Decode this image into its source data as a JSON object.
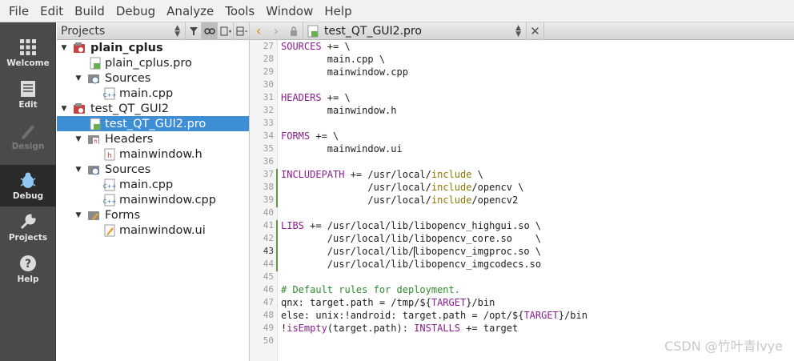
{
  "menu": [
    "File",
    "Edit",
    "Build",
    "Debug",
    "Analyze",
    "Tools",
    "Window",
    "Help"
  ],
  "modes": [
    {
      "label": "Welcome",
      "icon": "grid-icon",
      "state": "normal"
    },
    {
      "label": "Edit",
      "icon": "document-icon",
      "state": "normal"
    },
    {
      "label": "Design",
      "icon": "pen-icon",
      "state": "disabled"
    },
    {
      "label": "Debug",
      "icon": "bug-icon",
      "state": "active"
    },
    {
      "label": "Projects",
      "icon": "wrench-icon",
      "state": "normal"
    },
    {
      "label": "Help",
      "icon": "help-icon",
      "state": "normal"
    }
  ],
  "projects": {
    "title": "Projects",
    "tree": [
      {
        "label": "plain_cplus",
        "icon": "project-icon",
        "expanded": true,
        "bold": true
      },
      {
        "label": "plain_cplus.pro",
        "icon": "pro-file-icon"
      },
      {
        "label": "Sources",
        "icon": "sources-folder-icon",
        "expanded": true
      },
      {
        "label": "main.cpp",
        "icon": "cpp-file-icon"
      },
      {
        "label": "test_QT_GUI2",
        "icon": "project-icon",
        "expanded": true
      },
      {
        "label": "test_QT_GUI2.pro",
        "icon": "pro-file-icon",
        "selected": true
      },
      {
        "label": "Headers",
        "icon": "headers-folder-icon",
        "expanded": true
      },
      {
        "label": "mainwindow.h",
        "icon": "header-file-icon"
      },
      {
        "label": "Sources",
        "icon": "sources-folder-icon",
        "expanded": true
      },
      {
        "label": "main.cpp",
        "icon": "cpp-file-icon"
      },
      {
        "label": "mainwindow.cpp",
        "icon": "cpp-file-icon"
      },
      {
        "label": "Forms",
        "icon": "forms-folder-icon",
        "expanded": true
      },
      {
        "label": "mainwindow.ui",
        "icon": "ui-file-icon"
      }
    ]
  },
  "editor": {
    "file_name": "test_QT_GUI2.pro",
    "current_line": 43,
    "lines": [
      {
        "n": "27",
        "text": "SOURCES += \\"
      },
      {
        "n": "28",
        "text": "        main.cpp \\"
      },
      {
        "n": "29",
        "text": "        mainwindow.cpp"
      },
      {
        "n": "30",
        "text": ""
      },
      {
        "n": "31",
        "text": "HEADERS += \\"
      },
      {
        "n": "32",
        "text": "        mainwindow.h"
      },
      {
        "n": "33",
        "text": ""
      },
      {
        "n": "34",
        "text": "FORMS += \\"
      },
      {
        "n": "35",
        "text": "        mainwindow.ui"
      },
      {
        "n": "36",
        "text": ""
      },
      {
        "n": "37",
        "text": "INCLUDEPATH += /usr/local/include \\"
      },
      {
        "n": "38",
        "text": "               /usr/local/include/opencv \\"
      },
      {
        "n": "39",
        "text": "               /usr/local/include/opencv2"
      },
      {
        "n": "40",
        "text": ""
      },
      {
        "n": "41",
        "text": "LIBS += /usr/local/lib/libopencv_highgui.so \\"
      },
      {
        "n": "42",
        "text": "        /usr/local/lib/libopencv_core.so    \\"
      },
      {
        "n": "43",
        "text": "        /usr/local/lib/libopencv_imgproc.so \\"
      },
      {
        "n": "44",
        "text": "        /usr/local/lib/libopencv_imgcodecs.so"
      },
      {
        "n": "45",
        "text": ""
      },
      {
        "n": "46",
        "text": "# Default rules for deployment."
      },
      {
        "n": "47",
        "text": "qnx: target.path = /tmp/$${TARGET}/bin"
      },
      {
        "n": "48",
        "text": "else: unix:!android: target.path = /opt/$${TARGET}/bin"
      },
      {
        "n": "49",
        "text": "!isEmpty(target.path): INSTALLS += target"
      },
      {
        "n": "50",
        "text": ""
      }
    ]
  },
  "watermark": "CSDN @竹叶青lvye",
  "colors": {
    "selection": "#3d8ed5",
    "modebar": "#4a4a4a",
    "keyword": "#8a1d8f",
    "comment": "#2e8b2e",
    "changed_marker": "#5a9a3a"
  }
}
